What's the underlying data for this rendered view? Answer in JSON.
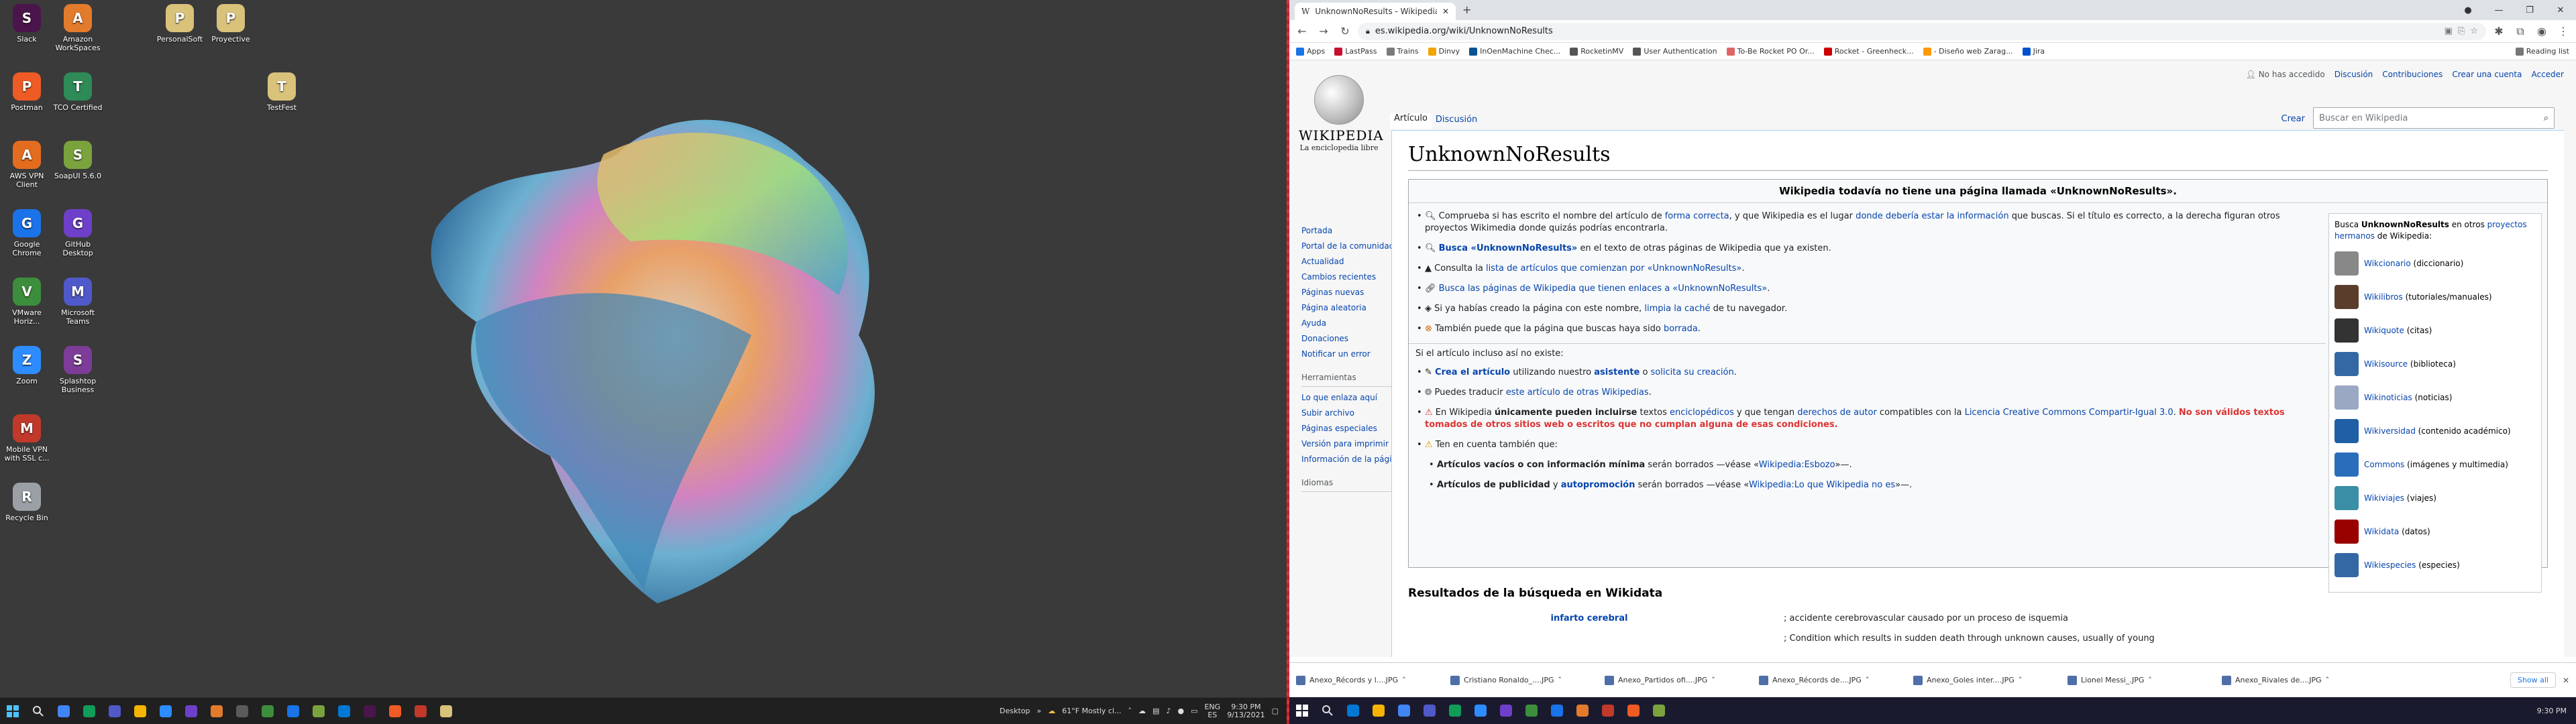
{
  "desktop": {
    "icons": [
      {
        "label": "Slack",
        "color": "#4a154b"
      },
      {
        "label": "Amazon WorkSpaces",
        "color": "#e37b2c"
      },
      {
        "label": "PersonalSoft",
        "color": "#d9c27a"
      },
      {
        "label": "Proyective",
        "color": "#d9c27a"
      },
      {
        "label": "Postman",
        "color": "#ef5b25"
      },
      {
        "label": "TCO Certified",
        "color": "#2e8b57"
      },
      {
        "label": "TestFest",
        "color": "#d9c27a"
      },
      {
        "label": "AWS VPN Client",
        "color": "#e36c1f"
      },
      {
        "label": "SoapUI 5.6.0",
        "color": "#7aa33d"
      },
      {
        "label": "Google Chrome",
        "color": "#1a73e8"
      },
      {
        "label": "GitHub Desktop",
        "color": "#6e40c9"
      },
      {
        "label": "VMware Horiz...",
        "color": "#3c8e3c"
      },
      {
        "label": "Microsoft Teams",
        "color": "#5059c9"
      },
      {
        "label": "Zoom",
        "color": "#2d8cff"
      },
      {
        "label": "Splashtop Business",
        "color": "#7d3c98"
      },
      {
        "label": "Mobile VPN with SSL c...",
        "color": "#c0392b"
      },
      {
        "label": "Recycle Bin",
        "color": "#9aa0a6"
      }
    ]
  },
  "taskbar_left": {
    "desktop_label": "Desktop",
    "weather": "61°F  Mostly cl...",
    "lang": "ENG",
    "lang2": "ES",
    "time": "9:30 PM",
    "date": "9/13/2021"
  },
  "browser": {
    "tab_title": "UnknownNoResults - Wikipedia, la",
    "new_tab": "+",
    "url": "es.wikipedia.org/wiki/UnknownNoResults",
    "bookmarks": [
      {
        "label": "Apps",
        "color": "#1a73e8"
      },
      {
        "label": "LastPass",
        "color": "#c8102e"
      },
      {
        "label": "Trains",
        "color": "#7a7a7a"
      },
      {
        "label": "Dinvy",
        "color": "#f0a500"
      },
      {
        "label": "InOenMachine Chec...",
        "color": "#0b5394"
      },
      {
        "label": "RocketinMV",
        "color": "#555"
      },
      {
        "label": "User Authentication",
        "color": "#555"
      },
      {
        "label": "To-Be Rocket PO Or...",
        "color": "#e06666"
      },
      {
        "label": "Rocket - Greenheck...",
        "color": "#cc0000"
      },
      {
        "label": "- Diseño web Zarag...",
        "color": "#ff9900"
      },
      {
        "label": "Jira",
        "color": "#0052cc"
      }
    ],
    "reading_list": "Reading list"
  },
  "wiki": {
    "wordmark": "WIKIPEDIA",
    "tagline": "La enciclopedia libre",
    "personal": {
      "not_logged": "No has accedido",
      "talk": "Discusión",
      "contribs": "Contribuciones",
      "create": "Crear una cuenta",
      "login": "Acceder"
    },
    "tab_article": "Artículo",
    "tab_talk": "Discusión",
    "create_btn": "Crear",
    "search_placeholder": "Buscar en Wikipedia",
    "nav": [
      "Portada",
      "Portal de la comunidad",
      "Actualidad",
      "Cambios recientes",
      "Páginas nuevas",
      "Página aleatoria",
      "Ayuda",
      "Donaciones",
      "Notificar un error"
    ],
    "tools_heading": "Herramientas",
    "tools": [
      "Lo que enlaza aquí",
      "Subir archivo",
      "Páginas especiales",
      "Versión para imprimir",
      "Información de la página"
    ],
    "lang_heading": "Idiomas",
    "title": "UnknownNoResults",
    "notice_heading": "Wikipedia todavía no tiene una página llamada «UnknownNoResults».",
    "b1_pre": "Comprueba si has escrito el nombre del artículo de ",
    "b1_l1": "forma correcta",
    "b1_mid": ", y que Wikipedia es el lugar ",
    "b1_l2": "donde debería estar la información",
    "b1_post": " que buscas. Si el título es correcto, a la derecha figuran otros proyectos Wikimedia donde quizás podrías encontrarla.",
    "b2_link": "Busca «UnknownNoResults»",
    "b2_post": " en el texto de otras páginas de Wikipedia que ya existen.",
    "b3_pre": "Consulta la ",
    "b3_link": "lista de artículos que comienzan por «UnknownNoResults»",
    "b3_post": ".",
    "b4_link": "Busca las páginas de Wikipedia que tienen enlaces a «UnknownNoResults»",
    "b4_post": ".",
    "b5_pre": "Si ya habías creado la página con este nombre, ",
    "b5_link": "limpia la caché",
    "b5_post": " de tu navegador.",
    "b6_pre": "También puede que la página que buscas haya sido ",
    "b6_link": "borrada",
    "b6_post": ".",
    "section2": "Si el artículo incluso así no existe:",
    "c1_link": "Crea el artículo",
    "c1_mid": " utilizando nuestro ",
    "c1_link2": "asistente",
    "c1_mid2": " o ",
    "c1_link3": "solicita su creación",
    "c1_post": ".",
    "c2_pre": "Puedes traducir ",
    "c2_link": "este artículo de otras Wikipedias",
    "c2_post": ".",
    "c3_pre": "En Wikipedia ",
    "c3_bold": "únicamente pueden incluirse",
    "c3_mid": " textos ",
    "c3_link": "enciclopédicos",
    "c3_mid2": " y que tengan ",
    "c3_link2": "derechos de autor",
    "c3_mid3": " compatibles con la ",
    "c3_link3": "Licencia Creative Commons Compartir-Igual 3.0",
    "c3_mid4": ". ",
    "c3_red": "No son válidos textos tomados de otros sitios web o escritos que no cumplan alguna de esas condiciones.",
    "c4": "Ten en cuenta también que:",
    "c4a_bold": "Artículos vacíos o con información mínima",
    "c4a_mid": " serán borrados —véase «",
    "c4a_link": "Wikipedia:Esbozo",
    "c4a_post": "»—.",
    "c4b_bold": "Artículos de publicidad",
    "c4b_mid": " y ",
    "c4b_link": "autopromoción",
    "c4b_mid2": " serán borrados —véase «",
    "c4b_link2": "Wikipedia:Lo que Wikipedia no es",
    "c4b_post": "»—.",
    "sisters_pre": "Busca ",
    "sisters_bold": "UnknownNoResults",
    "sisters_mid": " en otros ",
    "sisters_link": "proyectos hermanos",
    "sisters_post": " de Wikipedia:",
    "sisters": [
      {
        "name": "Wikcionario",
        "desc": " (diccionario)",
        "color": "#888"
      },
      {
        "name": "Wikilibros",
        "desc": " (tutoriales/manuales)",
        "color": "#5a3e2b"
      },
      {
        "name": "Wikiquote",
        "desc": " (citas)",
        "color": "#333"
      },
      {
        "name": "Wikisource",
        "desc": " (biblioteca)",
        "color": "#3468a4"
      },
      {
        "name": "Wikinoticias",
        "desc": " (noticias)",
        "color": "#9aa8c4"
      },
      {
        "name": "Wikiversidad",
        "desc": " (contenido académico)",
        "color": "#1f5fa6"
      },
      {
        "name": "Commons",
        "desc": " (imágenes y multimedia)",
        "color": "#2a6ebb"
      },
      {
        "name": "Wikiviajes",
        "desc": " (viajes)",
        "color": "#3a8ea6"
      },
      {
        "name": "Wikidata",
        "desc": " (datos)",
        "color": "#990000"
      },
      {
        "name": "Wikiespecies",
        "desc": " (especies)",
        "color": "#3468a4"
      }
    ],
    "wd_heading": "Resultados de la búsqueda en Wikidata",
    "wd_rows": [
      {
        "label": "infarto cerebral",
        "desc": "; accidente cerebrovascular causado por un proceso de isquemia"
      },
      {
        "label": "",
        "desc": "; Condition which results in sudden death through unknown causes, usually of young"
      }
    ]
  },
  "downloads": {
    "items": [
      "Anexo_Récords y l....JPG",
      "Cristiano Ronaldo_....JPG",
      "Anexo_Partidos ofi....JPG",
      "Anexo_Récords de....JPG",
      "Anexo_Goles inter....JPG",
      "Lionel Messi_.JPG",
      "Anexo_Rivales de....JPG"
    ],
    "show_all": "Show all"
  },
  "taskbar_right": {
    "time": "9:30 PM"
  }
}
